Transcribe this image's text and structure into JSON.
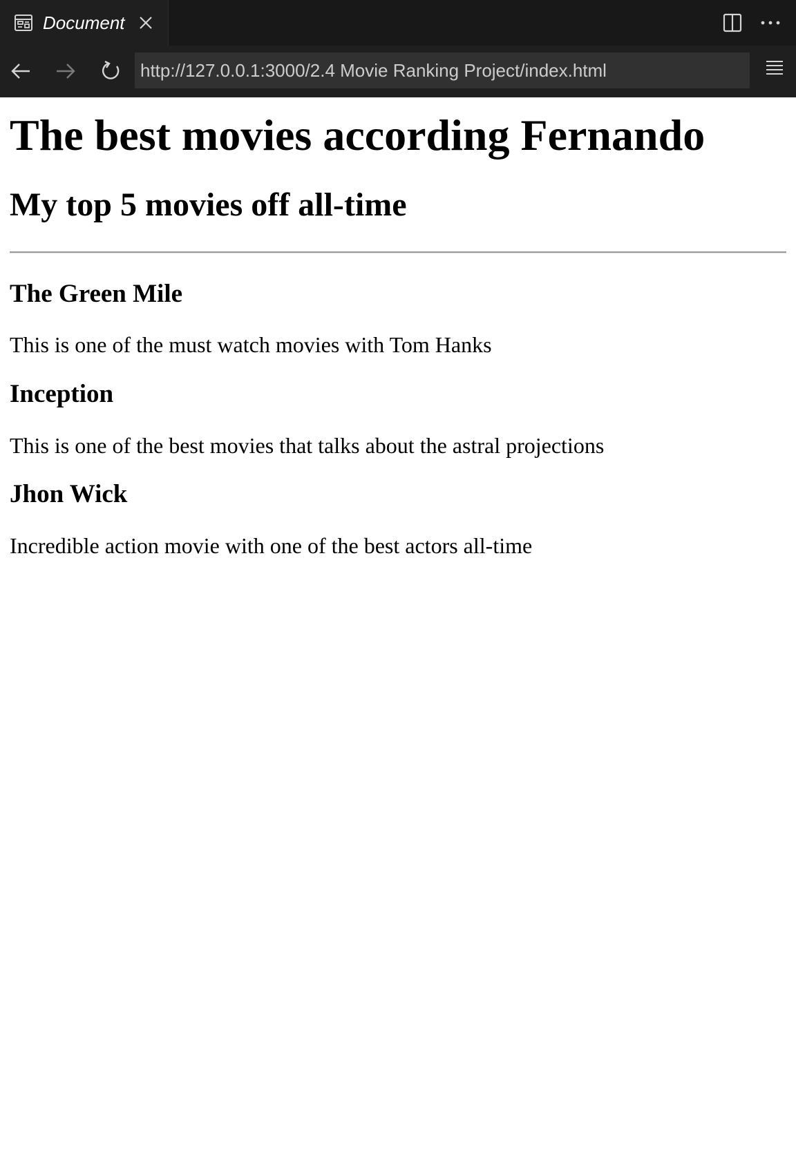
{
  "browser": {
    "tab": {
      "icon": "preview-icon",
      "title": "Document",
      "close_icon": "close-icon"
    },
    "toolbar_icons": [
      "split-editor-icon",
      "more-actions-icon"
    ],
    "nav": {
      "back_icon": "arrow-left-icon",
      "forward_icon": "arrow-right-icon",
      "reload_icon": "reload-icon",
      "url": "http://127.0.0.1:3000/2.4 Movie Ranking Project/index.html",
      "menu_icon": "hamburger-menu-icon"
    }
  },
  "page": {
    "title": "The best movies according Fernando",
    "subtitle": "My top 5 movies off all-time",
    "movies": [
      {
        "name": "The Green Mile",
        "description": "This is one of the must watch movies with Tom Hanks"
      },
      {
        "name": "Inception",
        "description": "This is one of the best movies that talks about the astral projections"
      },
      {
        "name": "Jhon Wick",
        "description": "Incredible action movie with one of the best actors all-time"
      }
    ]
  },
  "colors": {
    "chrome_bg": "#1f1f1f",
    "tabbar_bg": "#181818",
    "url_bg": "#313131",
    "page_bg": "#ffffff",
    "text": "#000000"
  }
}
